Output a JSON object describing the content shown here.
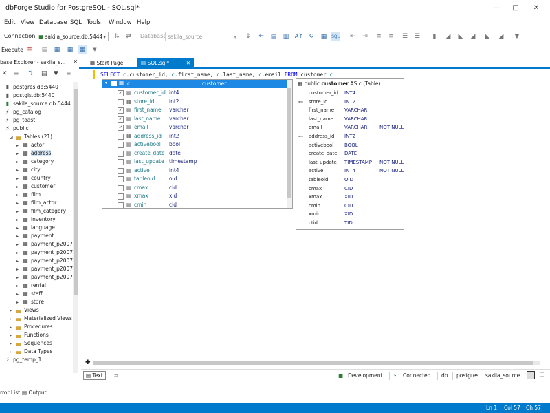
{
  "app": {
    "title": "dbForge Studio for PostgreSQL - SQL.sql*",
    "window_controls": [
      "minimize",
      "maximize",
      "close"
    ]
  },
  "menu": [
    "Edit",
    "View",
    "Database",
    "SQL",
    "Tools",
    "Window",
    "Help"
  ],
  "toolbar": {
    "connection_label": "Connection",
    "connection_value": "sakila_source.db:5444",
    "database_label": "Database",
    "database_value": "sakila_source",
    "execute_label": "Execute"
  },
  "db_explorer": {
    "title": "base Explorer - sakila_s...",
    "tree": [
      {
        "label": "postgres.db:5440",
        "icon": "database-icon",
        "level": 0,
        "state": "off"
      },
      {
        "label": "postgis.db:5440",
        "icon": "database-icon",
        "level": 0,
        "state": "off"
      },
      {
        "label": "sakila_source.db:5444",
        "icon": "database-icon",
        "level": 0,
        "state": "on"
      },
      {
        "label": "pg_catalog",
        "icon": "schema-icon",
        "level": 1
      },
      {
        "label": "pg_toast",
        "icon": "schema-icon",
        "level": 1
      },
      {
        "label": "public",
        "icon": "schema-icon",
        "level": 1
      },
      {
        "label": "Tables (21)",
        "icon": "folder-icon",
        "level": 2,
        "expanded": true
      },
      {
        "label": "actor",
        "icon": "table-icon",
        "level": 3
      },
      {
        "label": "address",
        "icon": "table-icon",
        "level": 3,
        "selected": true
      },
      {
        "label": "category",
        "icon": "table-icon",
        "level": 3
      },
      {
        "label": "city",
        "icon": "table-icon",
        "level": 3
      },
      {
        "label": "country",
        "icon": "table-icon",
        "level": 3
      },
      {
        "label": "customer",
        "icon": "table-icon",
        "level": 3
      },
      {
        "label": "film",
        "icon": "table-icon",
        "level": 3
      },
      {
        "label": "film_actor",
        "icon": "table-icon",
        "level": 3
      },
      {
        "label": "film_category",
        "icon": "table-icon",
        "level": 3
      },
      {
        "label": "inventory",
        "icon": "table-icon",
        "level": 3
      },
      {
        "label": "language",
        "icon": "table-icon",
        "level": 3
      },
      {
        "label": "payment",
        "icon": "table-icon",
        "level": 3
      },
      {
        "label": "payment_p2007",
        "icon": "table-icon",
        "level": 3
      },
      {
        "label": "payment_p2007",
        "icon": "table-icon",
        "level": 3
      },
      {
        "label": "payment_p2007",
        "icon": "table-icon",
        "level": 3
      },
      {
        "label": "payment_p2007",
        "icon": "table-icon",
        "level": 3
      },
      {
        "label": "payment_p2007",
        "icon": "table-icon",
        "level": 3
      },
      {
        "label": "rental",
        "icon": "table-icon",
        "level": 3
      },
      {
        "label": "staff",
        "icon": "table-icon",
        "level": 3
      },
      {
        "label": "store",
        "icon": "table-icon",
        "level": 3
      },
      {
        "label": "Views",
        "icon": "folder-icon",
        "level": 2
      },
      {
        "label": "Materialized Views",
        "icon": "folder-icon",
        "level": 2
      },
      {
        "label": "Procedures",
        "icon": "folder-icon",
        "level": 2
      },
      {
        "label": "Functions",
        "icon": "folder-icon",
        "level": 2
      },
      {
        "label": "Sequences",
        "icon": "folder-icon",
        "level": 2
      },
      {
        "label": "Data Types",
        "icon": "folder-icon",
        "level": 2
      },
      {
        "label": "pg_temp_1",
        "icon": "schema-icon",
        "level": 1
      }
    ]
  },
  "tabs": [
    {
      "label": "Start Page",
      "active": false
    },
    {
      "label": "SQL.sql*",
      "active": true
    }
  ],
  "editor": {
    "sql": {
      "select": "SELECT",
      "cols": [
        {
          "alias": "c",
          "col": "customer_id"
        },
        {
          "alias": "c",
          "col": "first_name"
        },
        {
          "alias": "c",
          "col": "last_name"
        },
        {
          "alias": "c",
          "col": "email"
        }
      ],
      "from": "FROM",
      "table": "customer",
      "table_alias": "c"
    }
  },
  "column_picker": {
    "header_alias": "c",
    "header_table": "customer",
    "rows": [
      {
        "name": "customer_id",
        "type": "int4",
        "checked": true,
        "icon": "key-icon"
      },
      {
        "name": "store_id",
        "type": "int2",
        "checked": false,
        "icon": "foreign-key-icon"
      },
      {
        "name": "first_name",
        "type": "varchar",
        "checked": true,
        "icon": "column-icon"
      },
      {
        "name": "last_name",
        "type": "varchar",
        "checked": true,
        "icon": "column-icon"
      },
      {
        "name": "email",
        "type": "varchar",
        "checked": true,
        "icon": "column-icon"
      },
      {
        "name": "address_id",
        "type": "int2",
        "checked": false,
        "icon": "foreign-key-icon"
      },
      {
        "name": "activebool",
        "type": "bool",
        "checked": false,
        "icon": "column-icon"
      },
      {
        "name": "create_date",
        "type": "date",
        "checked": false,
        "icon": "column-icon"
      },
      {
        "name": "last_update",
        "type": "timestamp",
        "checked": false,
        "icon": "column-icon"
      },
      {
        "name": "active",
        "type": "int4",
        "checked": false,
        "icon": "column-icon"
      },
      {
        "name": "tableoid",
        "type": "oid",
        "checked": false,
        "icon": "column-icon"
      },
      {
        "name": "cmax",
        "type": "cid",
        "checked": false,
        "icon": "column-icon"
      },
      {
        "name": "xmax",
        "type": "xid",
        "checked": false,
        "icon": "column-icon"
      },
      {
        "name": "cmin",
        "type": "cid",
        "checked": false,
        "icon": "column-icon"
      }
    ]
  },
  "table_info": {
    "schema": "public.",
    "table": "customer",
    "alias_suffix": " AS c (Table)",
    "rows": [
      {
        "name": "customer_id",
        "type": "INT4",
        "notnull": ""
      },
      {
        "name": "store_id",
        "type": "INT2",
        "notnull": "",
        "fk": true
      },
      {
        "name": "first_name",
        "type": "VARCHAR",
        "notnull": ""
      },
      {
        "name": "last_name",
        "type": "VARCHAR",
        "notnull": ""
      },
      {
        "name": "email",
        "type": "VARCHAR",
        "notnull": "NOT NULL"
      },
      {
        "name": "address_id",
        "type": "INT2",
        "notnull": "",
        "fk": true
      },
      {
        "name": "activebool",
        "type": "BOOL",
        "notnull": ""
      },
      {
        "name": "create_date",
        "type": "DATE",
        "notnull": ""
      },
      {
        "name": "last_update",
        "type": "TIMESTAMP",
        "notnull": "NOT NULL"
      },
      {
        "name": "active",
        "type": "INT4",
        "notnull": "NOT NULL"
      },
      {
        "name": "tableoid",
        "type": "OID",
        "notnull": ""
      },
      {
        "name": "cmax",
        "type": "CID",
        "notnull": ""
      },
      {
        "name": "xmax",
        "type": "XID",
        "notnull": ""
      },
      {
        "name": "cmin",
        "type": "CID",
        "notnull": ""
      },
      {
        "name": "xmin",
        "type": "XID",
        "notnull": ""
      },
      {
        "name": "ctid",
        "type": "TID",
        "notnull": ""
      }
    ]
  },
  "editor_status": {
    "text_tab": "Text",
    "environment": "Development",
    "connection_state": "Connected.",
    "db_label": "db",
    "user": "postgres",
    "database": "sakila_source"
  },
  "bottom_tabs": [
    "rror List",
    "Output"
  ],
  "statusbar": {
    "ln": "Ln 1",
    "col": "Col 57",
    "ch": "Ch 57"
  },
  "colors": {
    "accent": "#007acc",
    "connected": "#2e7d32",
    "keyword": "#0000ff",
    "column_name": "#1e7a8a",
    "type": "#1a237e"
  }
}
